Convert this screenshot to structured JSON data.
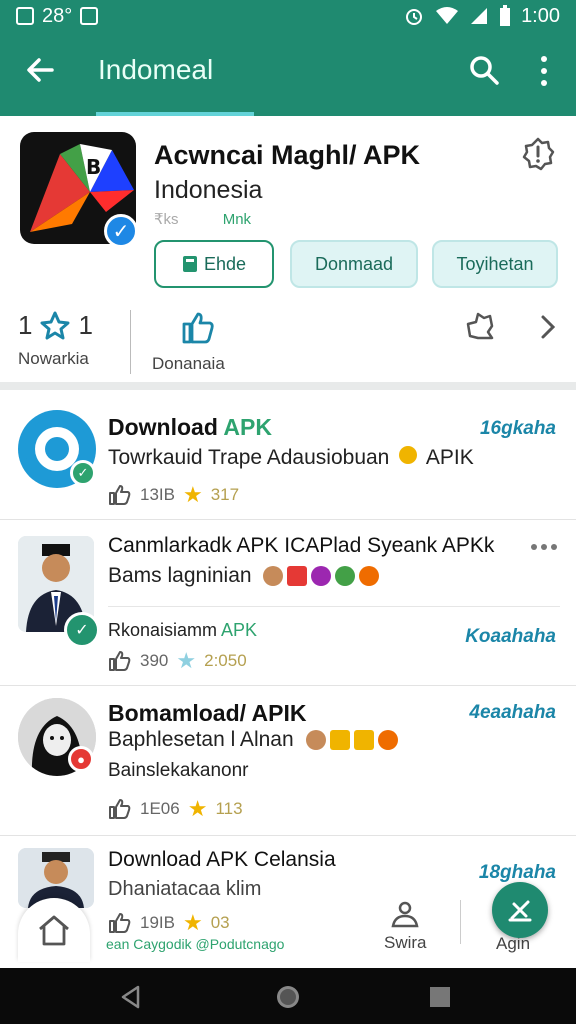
{
  "status_bar": {
    "time": "1:00",
    "left_text": "28°"
  },
  "app_bar": {
    "title": "Indomeal"
  },
  "header": {
    "title": "Acwncai Maghl/ APK",
    "subtitle": "Indonesia",
    "meta_left": "₹ks",
    "meta_right": "Mnk",
    "buttons": [
      "Ehde",
      "Donmaad",
      "Toyihetan"
    ],
    "stats": {
      "rating_left": "1",
      "rating_right": "1",
      "rating_label": "Nowarkia",
      "downloads_label": "Donanaia"
    }
  },
  "list": [
    {
      "title_a": "Download ",
      "title_b": "APK",
      "subtitle": "Towrkauid Trape Adausiobuan",
      "subtitle_tail": "APIK",
      "right": "16gkaha",
      "likes": "13IB",
      "stars": "317"
    },
    {
      "title": "Canmlarkadk APK ICAPlad Syeank APKk",
      "subtitle": "Bams lagninian",
      "line3_a": "Rkonaisiamm ",
      "line3_b": "APK",
      "right": "Koaahaha",
      "likes": "390",
      "stars": "2:050"
    },
    {
      "title": "Bomamload/ APIK",
      "subtitle": "Baphlesetan l Alnan",
      "line3": "Bainslekakanonr",
      "right": "4eaahaha",
      "likes": "1E06",
      "stars": "113"
    },
    {
      "title": "Download APK Celansia",
      "subtitle": "Dhaniatacaa klim",
      "right": "18ghaha",
      "likes": "19IB",
      "stars": "03"
    }
  ],
  "bottom": {
    "nav_middle": "Swira",
    "nav_right": "Agin",
    "footer_text": "ean Caygodik @Podutcnago"
  },
  "colors": {
    "primary": "#1f8a70",
    "accent": "#63d3d8",
    "link": "#1b86a8",
    "star": "#f0b400"
  }
}
